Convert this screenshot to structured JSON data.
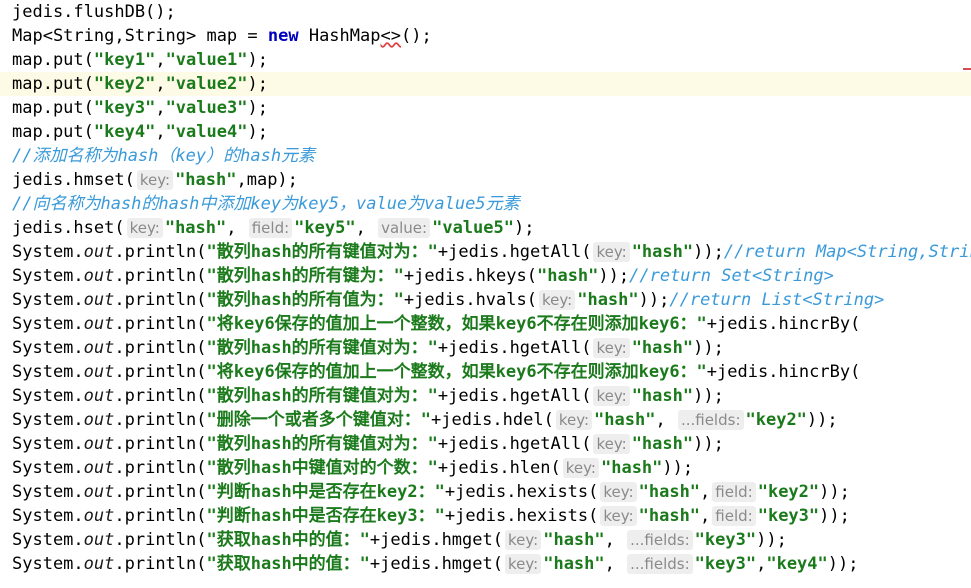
{
  "lines": [
    [
      {
        "t": "jedis.flushDB();"
      }
    ],
    [
      {
        "t": "Map<String,String> map = "
      },
      {
        "t": "new",
        "c": "kw"
      },
      {
        "t": " HashMap"
      },
      {
        "t": "<>",
        "c": "warn"
      },
      {
        "t": "();"
      }
    ],
    [
      {
        "t": "map.put("
      },
      {
        "t": "\"key1\"",
        "c": "str"
      },
      {
        "t": ","
      },
      {
        "t": "\"value1\"",
        "c": "str"
      },
      {
        "t": ");"
      }
    ],
    [
      {
        "t": "map.put("
      },
      {
        "t": "\"key2\"",
        "c": "str"
      },
      {
        "t": ","
      },
      {
        "t": "\"value2\"",
        "c": "str"
      },
      {
        "t": ");"
      }
    ],
    [
      {
        "t": "map.put("
      },
      {
        "t": "\"key3\"",
        "c": "str"
      },
      {
        "t": ","
      },
      {
        "t": "\"value3\"",
        "c": "str"
      },
      {
        "t": ");"
      }
    ],
    [
      {
        "t": "map.put("
      },
      {
        "t": "\"key4\"",
        "c": "str"
      },
      {
        "t": ","
      },
      {
        "t": "\"value4\"",
        "c": "str"
      },
      {
        "t": ");"
      }
    ],
    [
      {
        "t": "//添加名称为hash（key）的hash元素",
        "c": "cm"
      }
    ],
    [
      {
        "t": "jedis.hmset("
      },
      {
        "t": "key:",
        "c": "hint"
      },
      {
        "t": "\"hash\"",
        "c": "str"
      },
      {
        "t": ",map);"
      }
    ],
    [
      {
        "t": "//向名称为hash的hash中添加key为key5，value为value5元素",
        "c": "cm"
      }
    ],
    [
      {
        "t": "jedis.hset("
      },
      {
        "t": "key:",
        "c": "hint"
      },
      {
        "t": "\"hash\"",
        "c": "str"
      },
      {
        "t": ", "
      },
      {
        "t": "field:",
        "c": "hint"
      },
      {
        "t": "\"key5\"",
        "c": "str"
      },
      {
        "t": ", "
      },
      {
        "t": "value:",
        "c": "hint"
      },
      {
        "t": "\"value5\"",
        "c": "str"
      },
      {
        "t": ");"
      }
    ],
    [
      {
        "t": "System."
      },
      {
        "t": "out",
        "c": "fld"
      },
      {
        "t": ".println("
      },
      {
        "t": "\"散列hash的所有键值对为：\"",
        "c": "str"
      },
      {
        "t": "+jedis.hgetAll("
      },
      {
        "t": "key:",
        "c": "hint"
      },
      {
        "t": "\"hash\"",
        "c": "str"
      },
      {
        "t": "));"
      },
      {
        "t": "//return Map<String,String>",
        "c": "cm"
      }
    ],
    [
      {
        "t": "System."
      },
      {
        "t": "out",
        "c": "fld"
      },
      {
        "t": ".println("
      },
      {
        "t": "\"散列hash的所有键为：\"",
        "c": "str"
      },
      {
        "t": "+jedis.hkeys("
      },
      {
        "t": "\"hash\"",
        "c": "str"
      },
      {
        "t": "));"
      },
      {
        "t": "//return Set<String>",
        "c": "cm"
      }
    ],
    [
      {
        "t": "System."
      },
      {
        "t": "out",
        "c": "fld"
      },
      {
        "t": ".println("
      },
      {
        "t": "\"散列hash的所有值为：\"",
        "c": "str"
      },
      {
        "t": "+jedis.hvals("
      },
      {
        "t": "key:",
        "c": "hint"
      },
      {
        "t": "\"hash\"",
        "c": "str"
      },
      {
        "t": "));"
      },
      {
        "t": "//return List<String>",
        "c": "cm"
      }
    ],
    [
      {
        "t": "System."
      },
      {
        "t": "out",
        "c": "fld"
      },
      {
        "t": ".println("
      },
      {
        "t": "\"将key6保存的值加上一个整数，如果key6不存在则添加key6：\"",
        "c": "str"
      },
      {
        "t": "+jedis.hincrBy("
      }
    ],
    [
      {
        "t": "System."
      },
      {
        "t": "out",
        "c": "fld"
      },
      {
        "t": ".println("
      },
      {
        "t": "\"散列hash的所有键值对为：\"",
        "c": "str"
      },
      {
        "t": "+jedis.hgetAll("
      },
      {
        "t": "key:",
        "c": "hint"
      },
      {
        "t": "\"hash\"",
        "c": "str"
      },
      {
        "t": "));"
      }
    ],
    [
      {
        "t": "System."
      },
      {
        "t": "out",
        "c": "fld"
      },
      {
        "t": ".println("
      },
      {
        "t": "\"将key6保存的值加上一个整数，如果key6不存在则添加key6：\"",
        "c": "str"
      },
      {
        "t": "+jedis.hincrBy("
      }
    ],
    [
      {
        "t": "System."
      },
      {
        "t": "out",
        "c": "fld"
      },
      {
        "t": ".println("
      },
      {
        "t": "\"散列hash的所有键值对为：\"",
        "c": "str"
      },
      {
        "t": "+jedis.hgetAll("
      },
      {
        "t": "key:",
        "c": "hint"
      },
      {
        "t": "\"hash\"",
        "c": "str"
      },
      {
        "t": "));"
      }
    ],
    [
      {
        "t": "System."
      },
      {
        "t": "out",
        "c": "fld"
      },
      {
        "t": ".println("
      },
      {
        "t": "\"删除一个或者多个键值对：\"",
        "c": "str"
      },
      {
        "t": "+jedis.hdel("
      },
      {
        "t": "key:",
        "c": "hint"
      },
      {
        "t": "\"hash\"",
        "c": "str"
      },
      {
        "t": ", "
      },
      {
        "t": "...fields:",
        "c": "hint"
      },
      {
        "t": "\"key2\"",
        "c": "str"
      },
      {
        "t": "));"
      }
    ],
    [
      {
        "t": "System."
      },
      {
        "t": "out",
        "c": "fld"
      },
      {
        "t": ".println("
      },
      {
        "t": "\"散列hash的所有键值对为：\"",
        "c": "str"
      },
      {
        "t": "+jedis.hgetAll("
      },
      {
        "t": "key:",
        "c": "hint"
      },
      {
        "t": "\"hash\"",
        "c": "str"
      },
      {
        "t": "));"
      }
    ],
    [
      {
        "t": "System."
      },
      {
        "t": "out",
        "c": "fld"
      },
      {
        "t": ".println("
      },
      {
        "t": "\"散列hash中键值对的个数：\"",
        "c": "str"
      },
      {
        "t": "+jedis.hlen("
      },
      {
        "t": "key:",
        "c": "hint"
      },
      {
        "t": "\"hash\"",
        "c": "str"
      },
      {
        "t": "));"
      }
    ],
    [
      {
        "t": "System."
      },
      {
        "t": "out",
        "c": "fld"
      },
      {
        "t": ".println("
      },
      {
        "t": "\"判断hash中是否存在key2：\"",
        "c": "str"
      },
      {
        "t": "+jedis.hexists("
      },
      {
        "t": "key:",
        "c": "hint"
      },
      {
        "t": "\"hash\"",
        "c": "str"
      },
      {
        "t": ","
      },
      {
        "t": "field:",
        "c": "hint"
      },
      {
        "t": "\"key2\"",
        "c": "str"
      },
      {
        "t": "));"
      }
    ],
    [
      {
        "t": "System."
      },
      {
        "t": "out",
        "c": "fld"
      },
      {
        "t": ".println("
      },
      {
        "t": "\"判断hash中是否存在key3：\"",
        "c": "str"
      },
      {
        "t": "+jedis.hexists("
      },
      {
        "t": "key:",
        "c": "hint"
      },
      {
        "t": "\"hash\"",
        "c": "str"
      },
      {
        "t": ","
      },
      {
        "t": "field:",
        "c": "hint"
      },
      {
        "t": "\"key3\"",
        "c": "str"
      },
      {
        "t": "));"
      }
    ],
    [
      {
        "t": "System."
      },
      {
        "t": "out",
        "c": "fld"
      },
      {
        "t": ".println("
      },
      {
        "t": "\"获取hash中的值：\"",
        "c": "str"
      },
      {
        "t": "+jedis.hmget("
      },
      {
        "t": "key:",
        "c": "hint"
      },
      {
        "t": "\"hash\"",
        "c": "str"
      },
      {
        "t": ", "
      },
      {
        "t": "...fields:",
        "c": "hint"
      },
      {
        "t": "\"key3\"",
        "c": "str"
      },
      {
        "t": "));"
      }
    ],
    [
      {
        "t": "System."
      },
      {
        "t": "out",
        "c": "fld"
      },
      {
        "t": ".println("
      },
      {
        "t": "\"获取hash中的值：\"",
        "c": "str"
      },
      {
        "t": "+jedis.hmget("
      },
      {
        "t": "key:",
        "c": "hint"
      },
      {
        "t": "\"hash\"",
        "c": "str"
      },
      {
        "t": ", "
      },
      {
        "t": "...fields:",
        "c": "hint"
      },
      {
        "t": "\"key3\"",
        "c": "str"
      },
      {
        "t": ","
      },
      {
        "t": "\"key4\"",
        "c": "str"
      },
      {
        "t": "));"
      }
    ]
  ],
  "highlight_line": 3,
  "colors": {
    "keyword": "#0000c0",
    "string": "#1b7a1b",
    "comment": "#3a9ad9",
    "hint_bg": "#eeeeee",
    "current_line": "#fdfbe6"
  }
}
